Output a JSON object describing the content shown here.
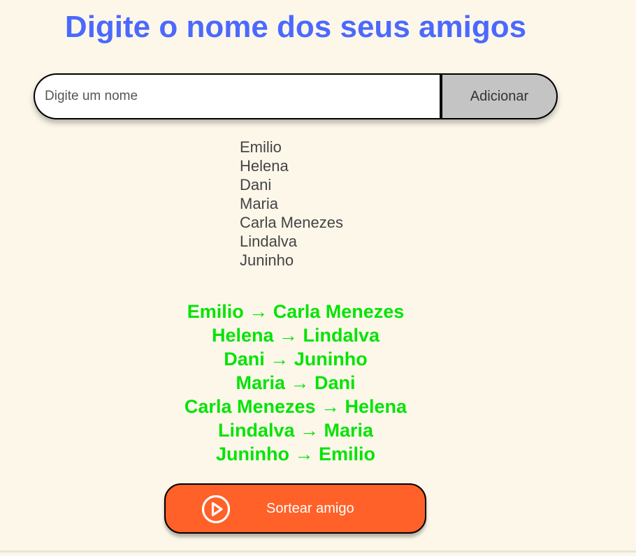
{
  "header": {
    "title": "Digite o nome dos seus amigos"
  },
  "form": {
    "input_placeholder": "Digite um nome",
    "input_value": "",
    "add_label": "Adicionar"
  },
  "friends": [
    "Emilio",
    "Helena",
    "Dani",
    "Maria",
    "Carla Menezes",
    "Lindalva",
    "Juninho"
  ],
  "results": [
    "Emilio → Carla Menezes",
    "Helena → Lindalva",
    "Dani → Juninho",
    "Maria → Dani",
    "Carla Menezes → Helena",
    "Lindalva → Maria",
    "Juninho → Emilio"
  ],
  "draw": {
    "label": "Sortear amigo",
    "icon": "play-circle-icon"
  },
  "colors": {
    "background": "#fdf7ea",
    "title": "#4b69fd",
    "result": "#05e305",
    "draw_button": "#ff6128",
    "add_button": "#c4c4c4"
  }
}
